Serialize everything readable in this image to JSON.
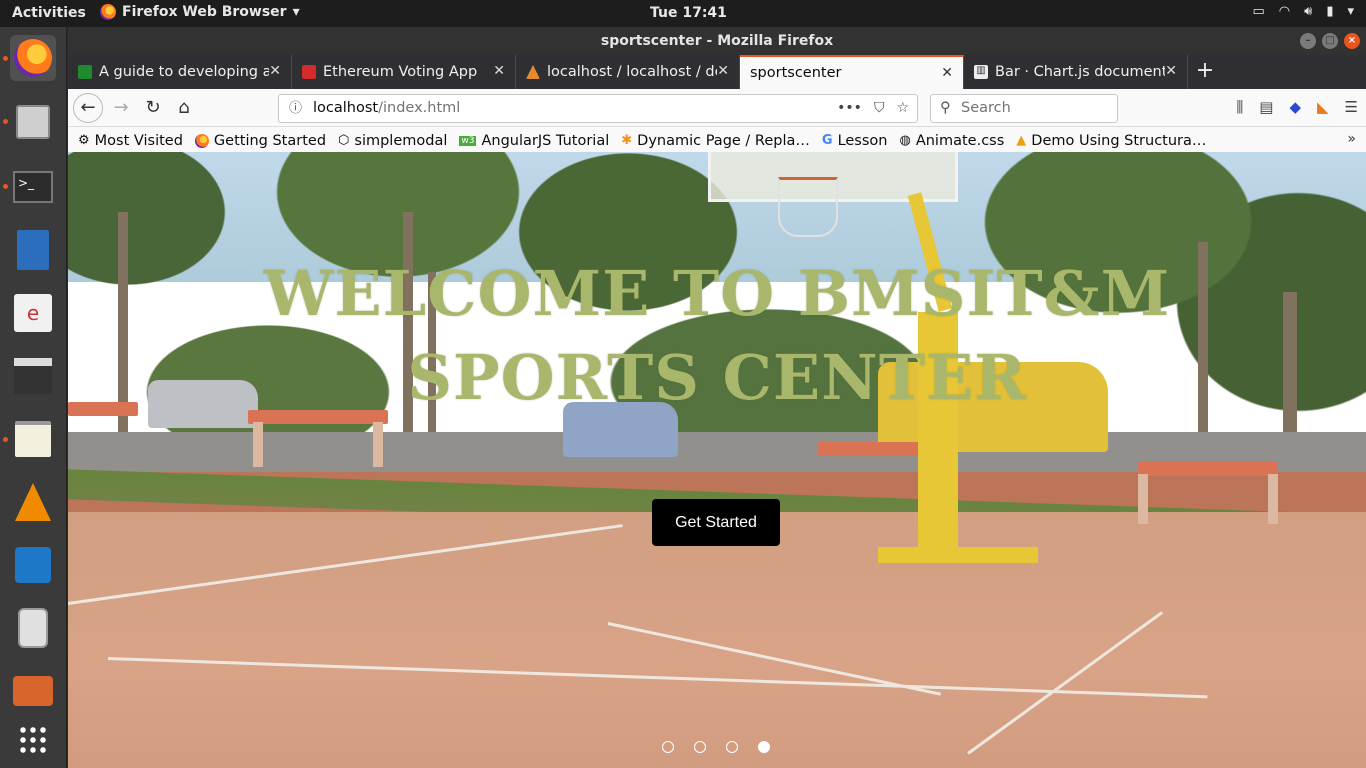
{
  "topbar": {
    "activities": "Activities",
    "app_name": "Firefox Web Browser",
    "clock": "Tue 17:41"
  },
  "window": {
    "title": "sportscenter - Mozilla Firefox"
  },
  "tabs": [
    {
      "label": "A guide to developing an",
      "favicon_color": "#1e8a2c"
    },
    {
      "label": "Ethereum Voting App",
      "favicon_color": "#d62b2b"
    },
    {
      "label": "localhost / localhost / de",
      "favicon_color": "#e68a2e"
    },
    {
      "label": "sportscenter",
      "favicon_color": ""
    },
    {
      "label": "Bar · Chart.js documenta",
      "favicon_color": "#333333"
    }
  ],
  "navbar": {
    "url_host": "localhost",
    "url_path": "/index.html",
    "search_placeholder": "Search"
  },
  "bookmarks": [
    {
      "label": "Most Visited",
      "icon": "gear-icon"
    },
    {
      "label": "Getting Started",
      "icon": "firefox-icon"
    },
    {
      "label": "simplemodal",
      "icon": "codepen-icon"
    },
    {
      "label": "AngularJS Tutorial",
      "icon": "w3-icon"
    },
    {
      "label": "Dynamic Page / Repla…",
      "icon": "star-icon"
    },
    {
      "label": "Lesson",
      "icon": "google-icon"
    },
    {
      "label": "Animate.css",
      "icon": "globe-icon"
    },
    {
      "label": "Demo Using Structura…",
      "icon": "drive-icon"
    }
  ],
  "hero": {
    "title": "WELCOME TO BMSIT&M SPORTS CENTER",
    "button": "Get Started",
    "slides_total": 4,
    "active_slide": 4
  },
  "colors": {
    "accent": "#e95420",
    "hero_title": "#a8b76c",
    "cta_bg": "#000000"
  }
}
